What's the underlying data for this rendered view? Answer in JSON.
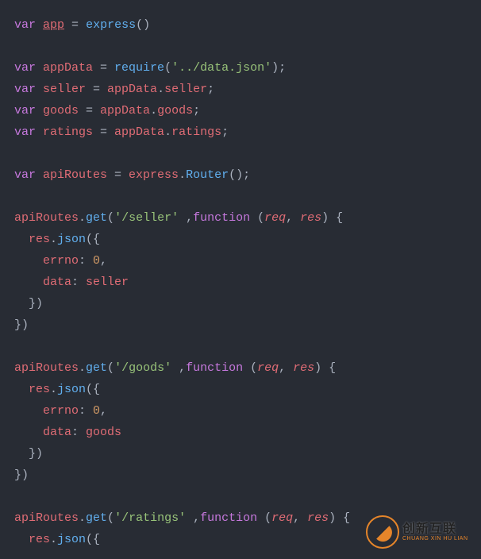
{
  "code": {
    "l1_var": "var",
    "l1_app": "app",
    "l1_eq": " = ",
    "l1_express": "express",
    "l1_paren": "()",
    "l3_var": "var",
    "l3_appData": " appData",
    "l3_eq": " = ",
    "l3_require": "require",
    "l3_paren_o": "(",
    "l3_str": "'../data.json'",
    "l3_paren_c": ");",
    "l4_var": "var",
    "l4_seller": " seller",
    "l4_eq": " = ",
    "l4_appData": "appData",
    "l4_dot": ".",
    "l4_prop": "seller",
    "l4_semi": ";",
    "l5_var": "var",
    "l5_goods": " goods",
    "l5_eq": " = ",
    "l5_appData": "appData",
    "l5_dot": ".",
    "l5_prop": "goods",
    "l5_semi": ";",
    "l6_var": "var",
    "l6_ratings": " ratings",
    "l6_eq": " = ",
    "l6_appData": "appData",
    "l6_dot": ".",
    "l6_prop": "ratings",
    "l6_semi": ";",
    "l8_var": "var",
    "l8_apiRoutes": " apiRoutes",
    "l8_eq": " = ",
    "l8_express": "express",
    "l8_dot": ".",
    "l8_router": "Router",
    "l8_paren": "();",
    "l10_apiRoutes": "apiRoutes",
    "l10_dot": ".",
    "l10_get": "get",
    "l10_paren_o": "(",
    "l10_str": "'/seller'",
    "l10_comma": " ,",
    "l10_function": "function",
    "l10_sp": " (",
    "l10_req": "req",
    "l10_c2": ", ",
    "l10_res": "res",
    "l10_pc": ") {",
    "l11_res": "  res",
    "l11_dot": ".",
    "l11_json": "json",
    "l11_paren": "({",
    "l12_errno": "    errno",
    "l12_colon": ": ",
    "l12_num": "0",
    "l12_c": ",",
    "l13_data": "    data",
    "l13_colon": ": ",
    "l13_val": "seller",
    "l14_close": "  })",
    "l15_close": "})",
    "l17_apiRoutes": "apiRoutes",
    "l17_dot": ".",
    "l17_get": "get",
    "l17_paren_o": "(",
    "l17_str": "'/goods'",
    "l17_comma": " ,",
    "l17_function": "function",
    "l17_sp": " (",
    "l17_req": "req",
    "l17_c2": ", ",
    "l17_res": "res",
    "l17_pc": ") {",
    "l18_res": "  res",
    "l18_dot": ".",
    "l18_json": "json",
    "l18_paren": "({",
    "l19_errno": "    errno",
    "l19_colon": ": ",
    "l19_num": "0",
    "l19_c": ",",
    "l20_data": "    data",
    "l20_colon": ": ",
    "l20_val": "goods",
    "l21_close": "  })",
    "l22_close": "})",
    "l24_apiRoutes": "apiRoutes",
    "l24_dot": ".",
    "l24_get": "get",
    "l24_paren_o": "(",
    "l24_str": "'/ratings'",
    "l24_comma": " ,",
    "l24_function": "function",
    "l24_sp": " (",
    "l24_req": "req",
    "l24_c2": ", ",
    "l24_res": "res",
    "l24_pc": ") {",
    "l25_res": "  res",
    "l25_dot": ".",
    "l25_json": "json",
    "l25_paren": "({"
  },
  "logo": {
    "cn": "创新互联",
    "en": "CHUANG XIN HU LIAN"
  }
}
